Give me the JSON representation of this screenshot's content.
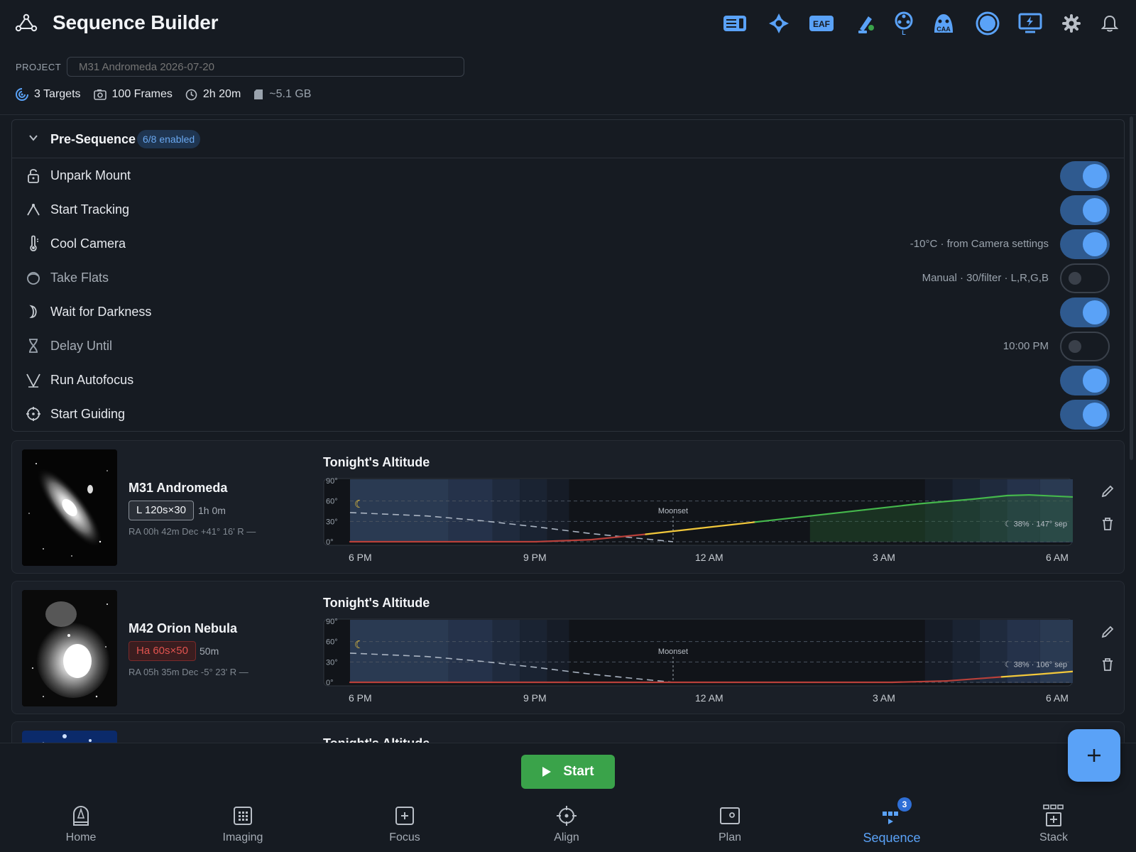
{
  "app": {
    "title": "Sequence Builder",
    "accent_color": "#5aa2f7"
  },
  "header": {
    "device_icons": [
      {
        "name": "camera-device-icon"
      },
      {
        "name": "mount-device-icon"
      },
      {
        "name": "eaf-device-icon",
        "label": "EAF"
      },
      {
        "name": "guider-device-icon"
      },
      {
        "name": "filter-wheel-device-icon",
        "label": "L"
      },
      {
        "name": "caa-device-icon",
        "label": "CAA"
      },
      {
        "name": "connection-status-icon"
      },
      {
        "name": "power-device-icon"
      },
      {
        "name": "settings-gear-icon"
      },
      {
        "name": "notifications-bell-icon"
      }
    ]
  },
  "project": {
    "label": "PROJECT",
    "value": "",
    "placeholder": "M31 Andromeda 2026-07-20"
  },
  "stats": {
    "targets": "3 Targets",
    "frames": "100 Frames",
    "time": "2h 20m",
    "storage": "~5.1 GB"
  },
  "pre_sequence": {
    "title": "Pre-Sequence",
    "badge": "6/8 enabled",
    "steps": [
      {
        "icon": "unlock-icon",
        "label": "Unpark Mount",
        "note": "",
        "enabled": true
      },
      {
        "icon": "tracking-icon",
        "label": "Start Tracking",
        "note": "",
        "enabled": true
      },
      {
        "icon": "thermometer-icon",
        "label": "Cool Camera",
        "note": "-10°C · from Camera settings",
        "enabled": true
      },
      {
        "icon": "flats-icon",
        "label": "Take Flats",
        "note": "Manual · 30/filter · L,R,G,B",
        "enabled": false
      },
      {
        "icon": "moon-icon",
        "label": "Wait for Darkness",
        "note": "",
        "enabled": true
      },
      {
        "icon": "hourglass-icon",
        "label": "Delay Until",
        "note": "10:00 PM",
        "enabled": false
      },
      {
        "icon": "autofocus-icon",
        "label": "Run Autofocus",
        "note": "",
        "enabled": true
      },
      {
        "icon": "crosshair-icon",
        "label": "Start Guiding",
        "note": "",
        "enabled": true
      }
    ]
  },
  "targets": [
    {
      "name": "M31 Andromeda",
      "filter": "L 120s×30",
      "filter_type": "lum",
      "duration": "1h 0m",
      "coords": "RA 00h 42m   Dec +41° 16'   R —",
      "chart_title": "Tonight's Altitude",
      "moonset_label": "Moonset",
      "moon_info": "38% · 147° sep",
      "x_ticks": [
        "6 PM",
        "9 PM",
        "12 AM",
        "3 AM",
        "6 AM"
      ],
      "y_ticks": [
        "90°",
        "60°",
        "30°",
        "0°"
      ]
    },
    {
      "name": "M42 Orion Nebula",
      "filter": "Ha 60s×50",
      "filter_type": "ha",
      "duration": "50m",
      "coords": "RA 05h 35m   Dec -5° 23'   R —",
      "chart_title": "Tonight's Altitude",
      "moonset_label": "Moonset",
      "moon_info": "38% · 106° sep",
      "x_ticks": [
        "6 PM",
        "9 PM",
        "12 AM",
        "3 AM",
        "6 AM"
      ],
      "y_ticks": [
        "90°",
        "60°",
        "30°",
        "0°"
      ]
    },
    {
      "chart_title": "Tonight's Altitude"
    }
  ],
  "chart_data": [
    {
      "type": "line",
      "title": "Tonight's Altitude",
      "x_hours": [
        17.6,
        19,
        20,
        21,
        22,
        23,
        24,
        25,
        26,
        27,
        28,
        29,
        29.6,
        30,
        30.8
      ],
      "series": [
        {
          "values": [
            0,
            0,
            0,
            0,
            3,
            11,
            20,
            29,
            38,
            47,
            56,
            63,
            68,
            69,
            66
          ]
        }
      ],
      "ylim": [
        0,
        90
      ],
      "xlim": [
        17.6,
        30.8
      ]
    },
    {
      "type": "line",
      "title": "Tonight's Altitude",
      "x_hours": [
        17.6,
        27.5,
        28.5,
        29.5,
        30.2,
        30.8
      ],
      "series": [
        {
          "values": [
            0,
            0,
            2,
            8,
            12,
            16
          ]
        }
      ],
      "ylim": [
        0,
        90
      ],
      "xlim": [
        17.6,
        30.8
      ]
    }
  ],
  "start": {
    "label": "Start"
  },
  "nav": {
    "items": [
      {
        "icon": "home-icon",
        "label": "Home"
      },
      {
        "icon": "imaging-icon",
        "label": "Imaging"
      },
      {
        "icon": "focus-icon",
        "label": "Focus"
      },
      {
        "icon": "align-icon",
        "label": "Align"
      },
      {
        "icon": "plan-icon",
        "label": "Plan"
      },
      {
        "icon": "sequence-icon",
        "label": "Sequence",
        "badge": "3",
        "active": true
      },
      {
        "icon": "stack-icon",
        "label": "Stack"
      }
    ]
  }
}
